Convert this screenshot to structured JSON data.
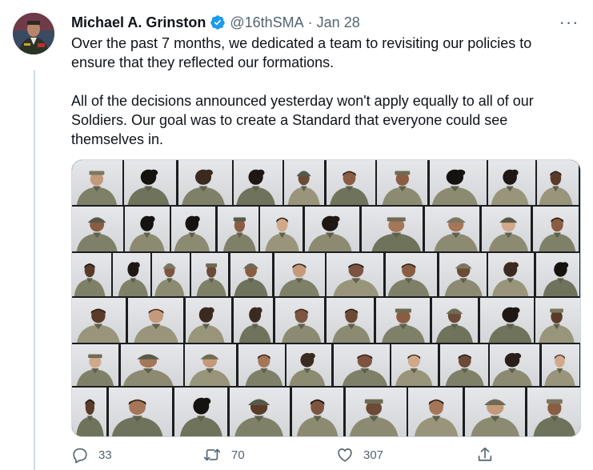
{
  "tweet": {
    "author_name": "Michael A. Grinston",
    "handle": "@16thSMA",
    "separator": "·",
    "date": "Jan 28",
    "more_label": "···",
    "paragraphs": [
      "Over the past 7 months, we dedicated a team to revisiting our policies to ensure that they reflected our formations.",
      "All of the decisions announced yesterday won't apply equally to all of our Soldiers. Our goal was to create a Standard that everyone could see themselves in."
    ]
  },
  "actions": {
    "reply_count": "33",
    "retweet_count": "70",
    "like_count": "307"
  },
  "colors": {
    "verified": "#1d9bf0",
    "muted": "#536471",
    "thread_line": "#cfd9de"
  },
  "icons": {
    "verified": "verified-badge-icon",
    "reply": "reply-icon",
    "retweet": "retweet-icon",
    "like": "heart-icon",
    "share": "share-icon",
    "more": "more-icon"
  }
}
